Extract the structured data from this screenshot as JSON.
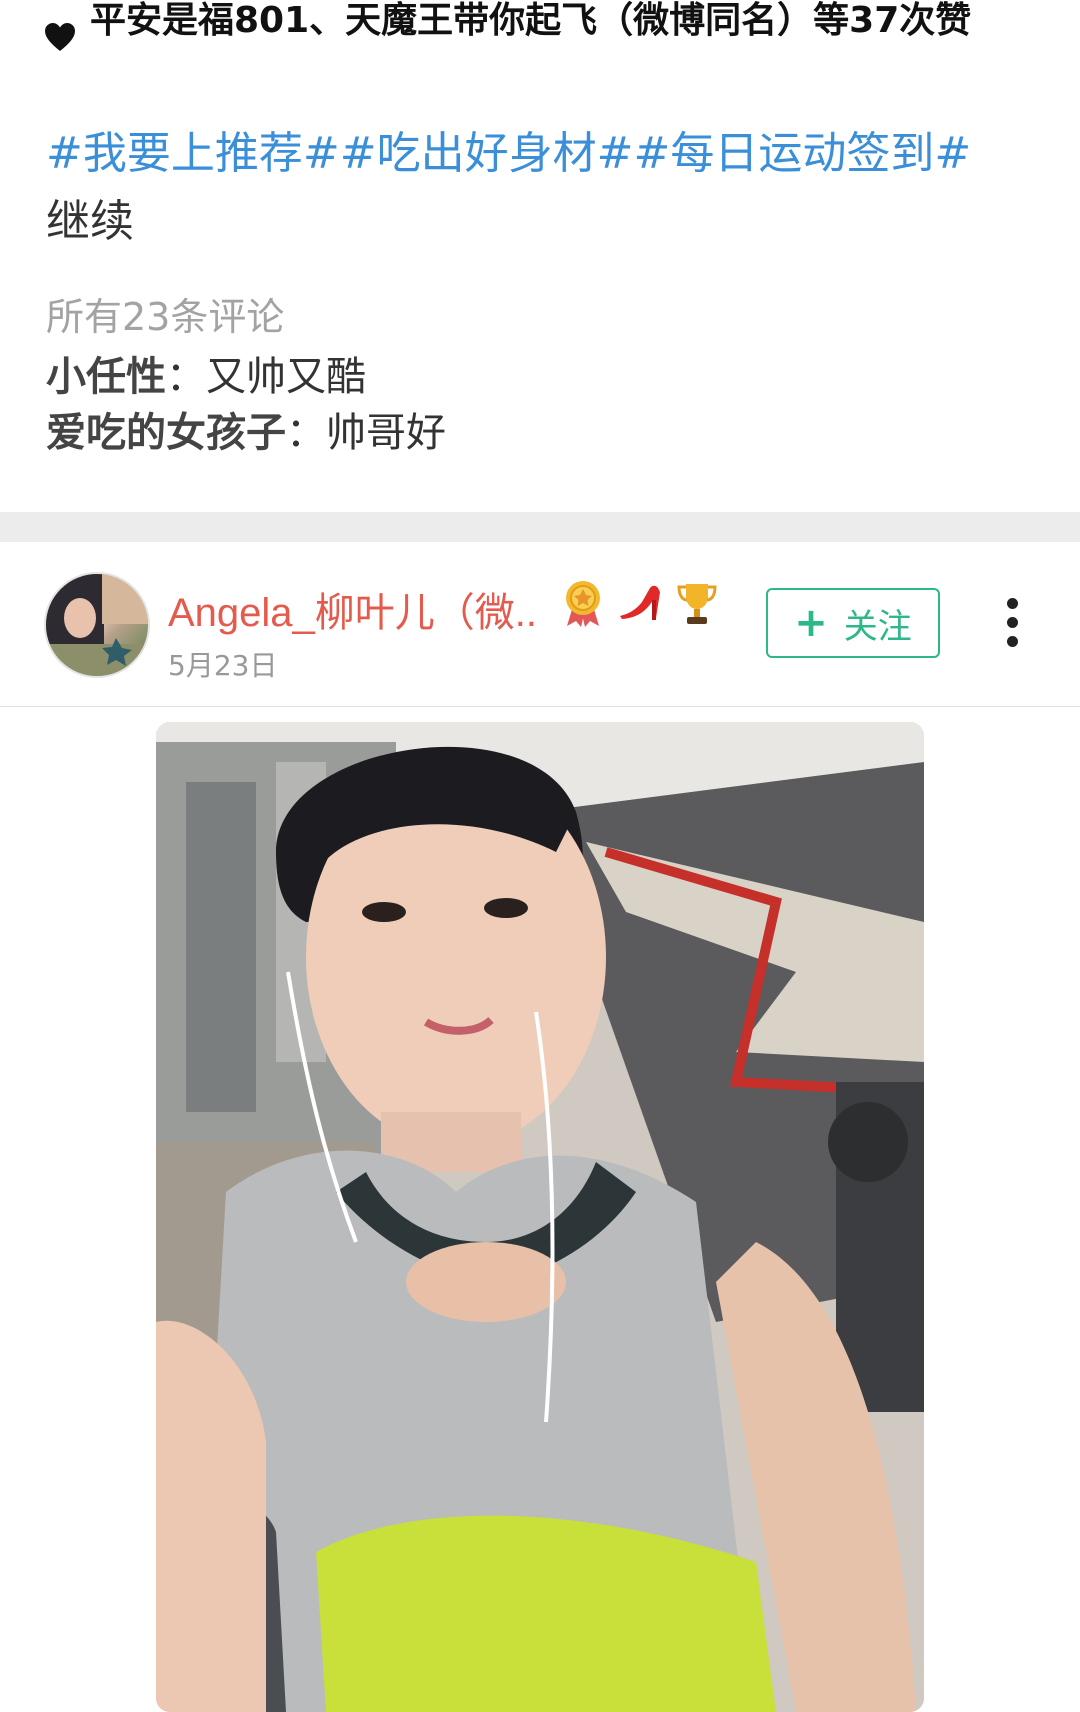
{
  "likes": {
    "text": "平安是福801、天魔王带你起飞（微博同名）等37次赞"
  },
  "post": {
    "hashtags": [
      "#我要上推荐#",
      "#吃出好身材#",
      "#每日运动签到#"
    ],
    "more_label": "继续"
  },
  "comments": {
    "total_label": "所有23条评论",
    "items": [
      {
        "author": "小任性",
        "separator": "：",
        "text": "又帅又酷"
      },
      {
        "author": "爱吃的女孩子",
        "separator": "：",
        "text": "帅哥好"
      }
    ]
  },
  "next_post": {
    "username": "Angela_柳叶儿（微..",
    "date": "5月23日",
    "follow_label": "关注",
    "badges": [
      "medal-icon",
      "high-heel-icon",
      "trophy-icon"
    ],
    "colors": {
      "username": "#e45b4e",
      "follow": "#2db88a",
      "hashtag": "#3a8fd8"
    }
  }
}
